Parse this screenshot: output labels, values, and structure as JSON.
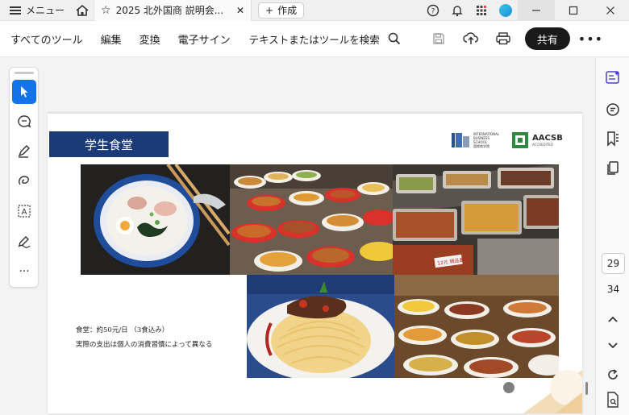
{
  "titlebar": {
    "menu_label": "メニュー",
    "tab_title": "2025 北外国商 説明会...",
    "create_label": "作成"
  },
  "toolbar": {
    "all_tools": "すべてのツール",
    "edit": "編集",
    "convert": "変換",
    "e_sign": "電子サイン",
    "search_placeholder": "テキストまたはツールを検索",
    "share_label": "共有",
    "more_label": "•••"
  },
  "left_rail": {
    "tools": [
      "select-tool",
      "comment-tool",
      "draw-tool",
      "freehand-tool",
      "text-select-tool",
      "fill-sign-tool",
      "more-tools"
    ],
    "more_label": "···"
  },
  "slide": {
    "title": "学生食堂",
    "logo_ibs_lines": [
      "INTERNATIONAL",
      "BUSINESS",
      "SCHOOL",
      "国際商学院"
    ],
    "logo_aacsb": "AACSB",
    "logo_aacsb_sub": "ACCREDITED",
    "caption_line1": "食堂：約50元/日 （3食込み）",
    "caption_line2": "実際の支出は個人の消費習慣によって異なる",
    "photo_label_tray": "12元 精品套餐"
  },
  "right_rail": {
    "current_page": "29",
    "total_pages": "34"
  },
  "colors": {
    "accent_blue": "#1473e6",
    "slide_title_bg": "#1a3a78",
    "share_bg": "#1a1a1a"
  }
}
